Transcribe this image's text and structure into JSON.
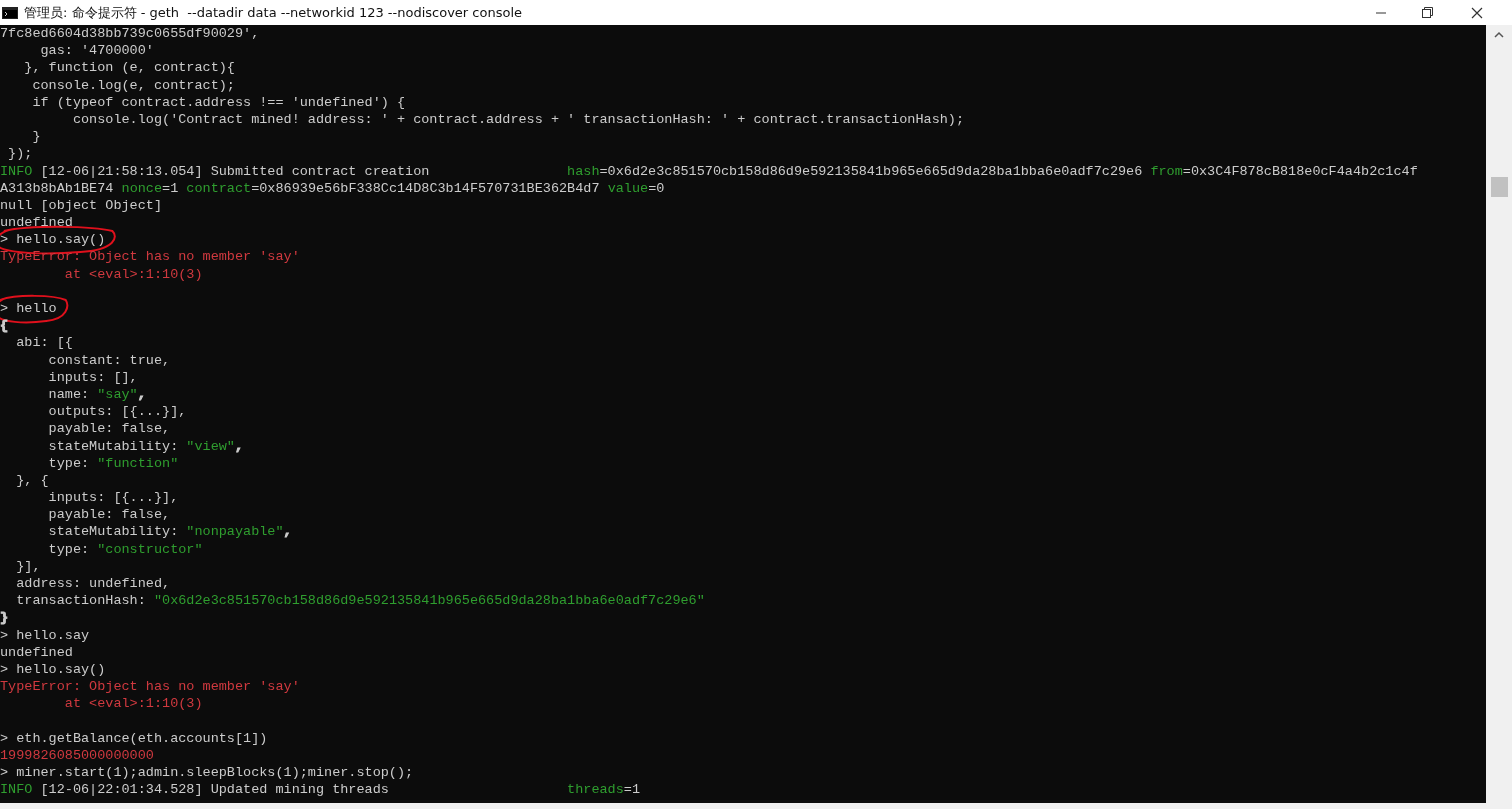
{
  "window": {
    "title": "管理员: 命令提示符 - geth  --datadir data --networkid 123 --nodiscover console"
  },
  "console": {
    "lines": [
      {
        "circled": false,
        "segments": [
          {
            "color": "#cccccc",
            "text": "7fc8ed6604d38bb739c0655df90029',"
          }
        ]
      },
      {
        "circled": false,
        "segments": [
          {
            "color": "#cccccc",
            "text": "     gas: '4700000'"
          }
        ]
      },
      {
        "circled": false,
        "segments": [
          {
            "color": "#cccccc",
            "text": "   }, function (e, contract){"
          }
        ]
      },
      {
        "circled": false,
        "segments": [
          {
            "color": "#cccccc",
            "text": "    console.log(e, contract);"
          }
        ]
      },
      {
        "circled": false,
        "segments": [
          {
            "color": "#cccccc",
            "text": "    if (typeof contract.address !== 'undefined') {"
          }
        ]
      },
      {
        "circled": false,
        "segments": [
          {
            "color": "#cccccc",
            "text": "         console.log('Contract mined! address: ' + contract.address + ' transactionHash: ' + contract.transactionHash);"
          }
        ]
      },
      {
        "circled": false,
        "segments": [
          {
            "color": "#cccccc",
            "text": "    }"
          }
        ]
      },
      {
        "circled": false,
        "segments": [
          {
            "color": "#cccccc",
            "text": " });"
          }
        ]
      },
      {
        "circled": false,
        "segments": [
          {
            "color": "#2f9e2f",
            "text": "INFO"
          },
          {
            "color": "#cccccc",
            "text": " [12-06|21:58:13.054] Submitted contract creation                 "
          },
          {
            "color": "#2f9e2f",
            "text": "hash"
          },
          {
            "color": "#cccccc",
            "text": "=0x6d2e3c851570cb158d86d9e592135841b965e665d9da28ba1bba6e0adf7c29e6 "
          },
          {
            "color": "#2f9e2f",
            "text": "from"
          },
          {
            "color": "#cccccc",
            "text": "=0x3C4F878cB818e0cF4a4b2c1c4f"
          }
        ]
      },
      {
        "circled": false,
        "segments": [
          {
            "color": "#cccccc",
            "text": "A313b8bAb1BE74 "
          },
          {
            "color": "#2f9e2f",
            "text": "nonce"
          },
          {
            "color": "#cccccc",
            "text": "=1 "
          },
          {
            "color": "#2f9e2f",
            "text": "contract"
          },
          {
            "color": "#cccccc",
            "text": "=0x86939e56bF338Cc14D8C3b14F570731BE362B4d7 "
          },
          {
            "color": "#2f9e2f",
            "text": "value"
          },
          {
            "color": "#cccccc",
            "text": "=0"
          }
        ]
      },
      {
        "circled": false,
        "segments": [
          {
            "color": "#cccccc",
            "text": "null [object Object]"
          }
        ]
      },
      {
        "circled": false,
        "segments": [
          {
            "color": "#cccccc",
            "text": "undefined"
          }
        ]
      },
      {
        "circled": true,
        "segments": [
          {
            "color": "#cccccc",
            "text": "> hello.say()"
          }
        ]
      },
      {
        "circled": false,
        "segments": [
          {
            "color": "#d0393f",
            "text": "TypeError: Object has no member 'say'"
          }
        ]
      },
      {
        "circled": false,
        "segments": [
          {
            "color": "#d0393f",
            "text": "        at <eval>:1:10(3)"
          }
        ]
      },
      {
        "circled": false
      },
      {
        "circled": true,
        "segments": [
          {
            "color": "#cccccc",
            "text": "> hello"
          }
        ]
      },
      {
        "circled": false,
        "segments": [
          {
            "color": "#cccccc",
            "text": "{"
          }
        ]
      },
      {
        "circled": false,
        "segments": [
          {
            "color": "#cccccc",
            "text": "  abi: [{"
          }
        ]
      },
      {
        "circled": false,
        "segments": [
          {
            "color": "#cccccc",
            "text": "      constant: true,"
          }
        ]
      },
      {
        "circled": false,
        "segments": [
          {
            "color": "#cccccc",
            "text": "      inputs: [],"
          }
        ]
      },
      {
        "circled": false,
        "segments": [
          {
            "color": "#cccccc",
            "text": "      name: "
          },
          {
            "color": "#2f9e2f",
            "text": "\"say\""
          },
          {
            "color": "#cccccc",
            "text": ","
          }
        ]
      },
      {
        "circled": false,
        "segments": [
          {
            "color": "#cccccc",
            "text": "      outputs: [{...}],"
          }
        ]
      },
      {
        "circled": false,
        "segments": [
          {
            "color": "#cccccc",
            "text": "      payable: false,"
          }
        ]
      },
      {
        "circled": false,
        "segments": [
          {
            "color": "#cccccc",
            "text": "      stateMutability: "
          },
          {
            "color": "#2f9e2f",
            "text": "\"view\""
          },
          {
            "color": "#cccccc",
            "text": ","
          }
        ]
      },
      {
        "circled": false,
        "segments": [
          {
            "color": "#cccccc",
            "text": "      type: "
          },
          {
            "color": "#2f9e2f",
            "text": "\"function\""
          }
        ]
      },
      {
        "circled": false,
        "segments": [
          {
            "color": "#cccccc",
            "text": "  }, {"
          }
        ]
      },
      {
        "circled": false,
        "segments": [
          {
            "color": "#cccccc",
            "text": "      inputs: [{...}],"
          }
        ]
      },
      {
        "circled": false,
        "segments": [
          {
            "color": "#cccccc",
            "text": "      payable: false,"
          }
        ]
      },
      {
        "circled": false,
        "segments": [
          {
            "color": "#cccccc",
            "text": "      stateMutability: "
          },
          {
            "color": "#2f9e2f",
            "text": "\"nonpayable\""
          },
          {
            "color": "#cccccc",
            "text": ","
          }
        ]
      },
      {
        "circled": false,
        "segments": [
          {
            "color": "#cccccc",
            "text": "      type: "
          },
          {
            "color": "#2f9e2f",
            "text": "\"constructor\""
          }
        ]
      },
      {
        "circled": false,
        "segments": [
          {
            "color": "#cccccc",
            "text": "  }],"
          }
        ]
      },
      {
        "circled": false,
        "segments": [
          {
            "color": "#cccccc",
            "text": "  address: undefined,"
          }
        ]
      },
      {
        "circled": false,
        "segments": [
          {
            "color": "#cccccc",
            "text": "  transactionHash: "
          },
          {
            "color": "#2f9e2f",
            "text": "\"0x6d2e3c851570cb158d86d9e592135841b965e665d9da28ba1bba6e0adf7c29e6\""
          }
        ]
      },
      {
        "circled": false,
        "segments": [
          {
            "color": "#cccccc",
            "text": "}"
          }
        ]
      },
      {
        "circled": false,
        "segments": [
          {
            "color": "#cccccc",
            "text": "> hello.say"
          }
        ]
      },
      {
        "circled": false,
        "segments": [
          {
            "color": "#cccccc",
            "text": "undefined"
          }
        ]
      },
      {
        "circled": false,
        "segments": [
          {
            "color": "#cccccc",
            "text": "> hello.say()"
          }
        ]
      },
      {
        "circled": false,
        "segments": [
          {
            "color": "#d0393f",
            "text": "TypeError: Object has no member 'say'"
          }
        ]
      },
      {
        "circled": false,
        "segments": [
          {
            "color": "#d0393f",
            "text": "        at <eval>:1:10(3)"
          }
        ]
      },
      {
        "circled": false
      },
      {
        "circled": false,
        "segments": [
          {
            "color": "#cccccc",
            "text": "> eth.getBalance(eth.accounts[1])"
          }
        ]
      },
      {
        "circled": false,
        "segments": [
          {
            "color": "#d0393f",
            "text": "1999826085000000000"
          }
        ]
      },
      {
        "circled": false,
        "segments": [
          {
            "color": "#cccccc",
            "text": "> miner.start(1);admin.sleepBlocks(1);miner.stop();"
          }
        ]
      },
      {
        "circled": false,
        "segments": [
          {
            "color": "#2f9e2f",
            "text": "INFO"
          },
          {
            "color": "#cccccc",
            "text": " [12-06|22:01:34.528] Updated mining threads                      "
          },
          {
            "color": "#2f9e2f",
            "text": "threads"
          },
          {
            "color": "#cccccc",
            "text": "=1"
          }
        ]
      }
    ]
  }
}
